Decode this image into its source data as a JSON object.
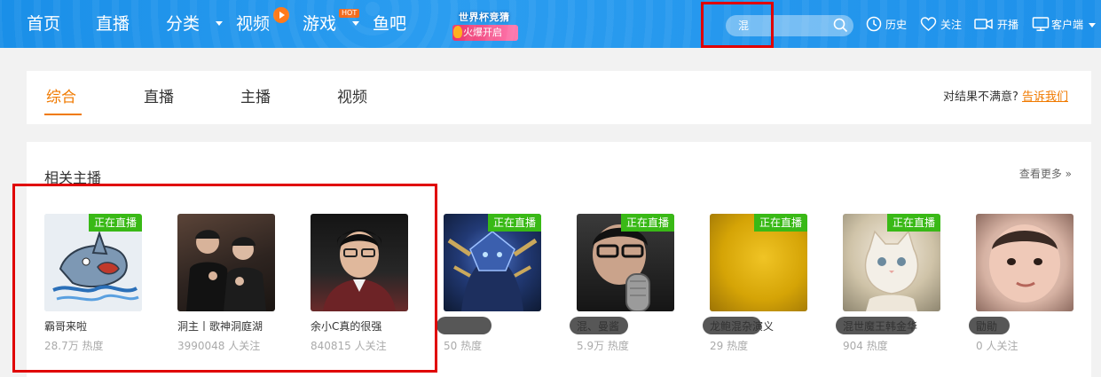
{
  "nav": {
    "items": [
      {
        "label": "首页"
      },
      {
        "label": "直播"
      },
      {
        "label": "分类"
      },
      {
        "label": "视频"
      },
      {
        "label": "游戏"
      },
      {
        "label": "鱼吧"
      }
    ],
    "hot_badge": "HOT",
    "promo": {
      "line1": "世界杯竞猜",
      "line2": "火爆开启"
    },
    "search": {
      "value": "混"
    },
    "tools": [
      {
        "label": "历史",
        "icon": "clock-icon"
      },
      {
        "label": "关注",
        "icon": "heart-icon"
      },
      {
        "label": "开播",
        "icon": "camera-icon"
      },
      {
        "label": "客户端",
        "icon": "monitor-icon"
      }
    ]
  },
  "tabs": [
    {
      "label": "综合",
      "active": true
    },
    {
      "label": "直播",
      "active": false
    },
    {
      "label": "主播",
      "active": false
    },
    {
      "label": "视频",
      "active": false
    }
  ],
  "feedback": {
    "question": "对结果不满意?",
    "link": "告诉我们"
  },
  "related": {
    "title": "相关主播",
    "more": "查看更多",
    "live_badge": "正在直播",
    "streamers": [
      {
        "name": "霸哥来啦",
        "stat": "28.7万 热度",
        "live": true
      },
      {
        "name": "洞主丨歌神洞庭湖",
        "stat": "3990048 人关注",
        "live": false
      },
      {
        "name": "余小C真的很强",
        "stat": "840815 人关注",
        "live": false
      },
      {
        "name": "",
        "stat": "50 热度",
        "live": true
      },
      {
        "name": "混、曼酱",
        "stat": "5.9万 热度",
        "live": true
      },
      {
        "name": "龙鲍混杂演义",
        "stat": "29 热度",
        "live": true
      },
      {
        "name": "混世魔王韩金华",
        "stat": "904 热度",
        "live": true
      },
      {
        "name": "勖勛",
        "stat": "0 人关注",
        "live": false
      }
    ]
  },
  "colors": {
    "accent": "#f07a00",
    "header": "#1a8fe8",
    "live": "#39b916",
    "highlight": "#e00000"
  }
}
